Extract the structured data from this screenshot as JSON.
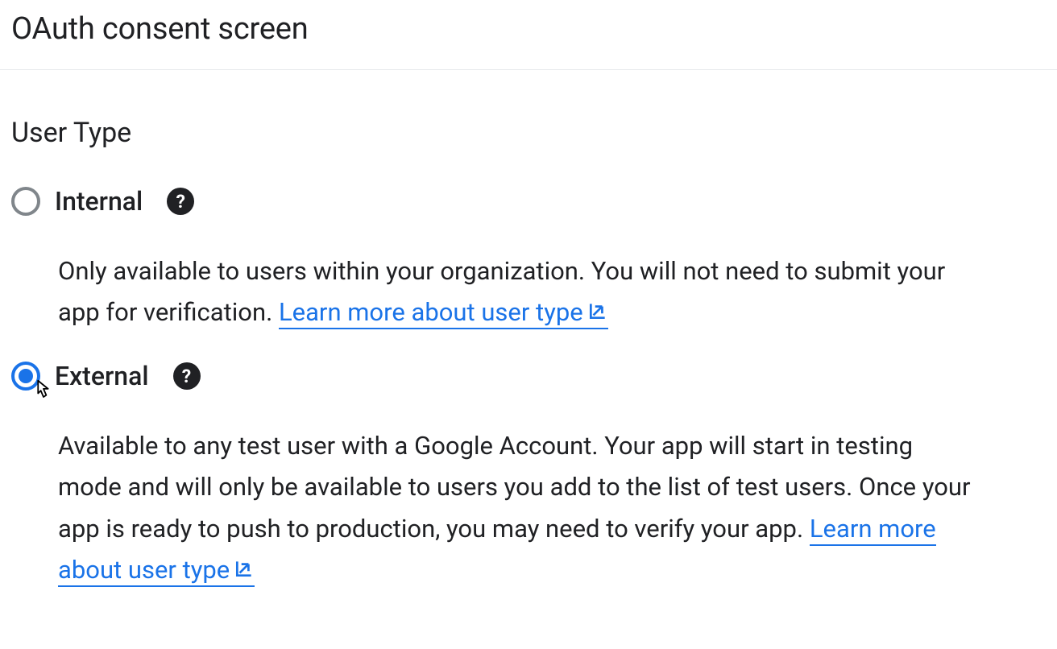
{
  "header": {
    "title": "OAuth consent screen"
  },
  "section": {
    "heading": "User Type"
  },
  "options": [
    {
      "label": "Internal",
      "description": "Only available to users within your organization. You will not need to submit your app for verification. ",
      "link_text": "Learn more about user type",
      "selected": false
    },
    {
      "label": "External",
      "description": "Available to any test user with a Google Account. Your app will start in testing mode and will only be available to users you add to the list of test users. Once your app is ready to push to production, you may need to verify your app. ",
      "link_text": "Learn more about user type",
      "selected": true
    }
  ]
}
